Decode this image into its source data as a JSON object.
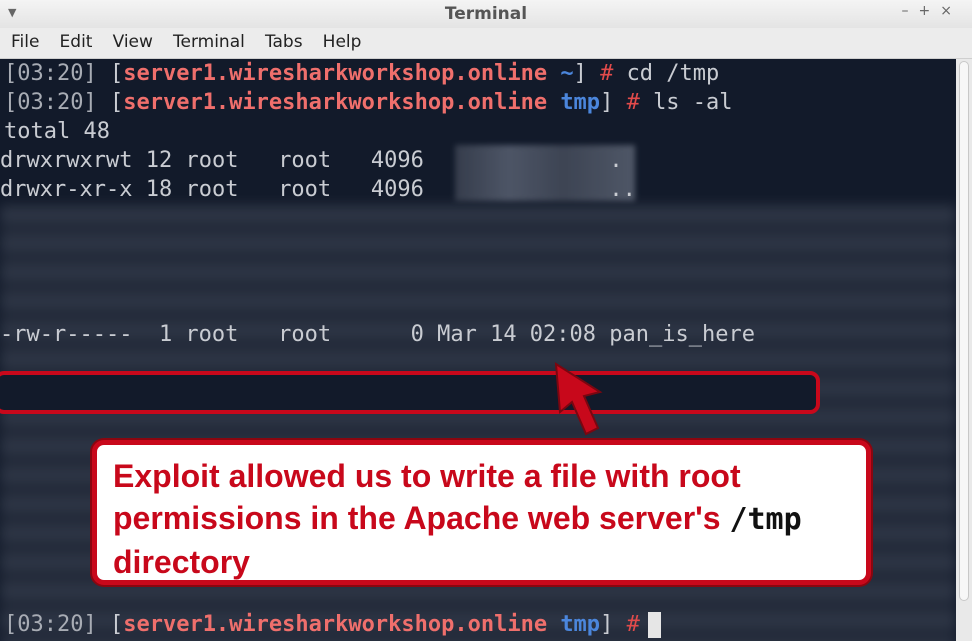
{
  "window": {
    "title": "Terminal",
    "menu_icon": "chevron-down-icon",
    "controls": [
      "minimize-icon",
      "maximize-icon",
      "close-icon"
    ]
  },
  "menu": {
    "items": [
      "File",
      "Edit",
      "View",
      "Terminal",
      "Tabs",
      "Help"
    ]
  },
  "terminal": {
    "lines": [
      {
        "time": "[03:20]",
        "host": "server1.wiresharkworkshop.online",
        "dir": "~",
        "cmd": "cd /tmp"
      },
      {
        "time": "[03:20]",
        "host": "server1.wiresharkworkshop.online",
        "dir": "tmp",
        "cmd": "ls -al"
      }
    ],
    "total": "total 48",
    "rows": [
      {
        "perm": "drwxrwxrwt",
        "links": "12",
        "user": "root",
        "group": "root",
        "size": "4096",
        "name": "."
      },
      {
        "perm": "drwxr-xr-x",
        "links": "18",
        "user": "root",
        "group": "root",
        "size": "4096",
        "name": ".."
      }
    ],
    "highlight_row": {
      "text": "-rw-r-----  1 root   root      0 Mar 14 02:08 pan_is_here"
    },
    "prompt": {
      "time": "[03:20]",
      "host": "server1.wiresharkworkshop.online",
      "dir": "tmp",
      "hash": "#"
    }
  },
  "callout": {
    "text_a": "Exploit allowed us to write a file with root permissions in the Apache web server's ",
    "code": "/tmp",
    "text_b": " directory"
  },
  "colors": {
    "accent": "#c8081b",
    "host": "#ef6f6c",
    "dir": "#4b86dc",
    "background": "#121a2a"
  }
}
